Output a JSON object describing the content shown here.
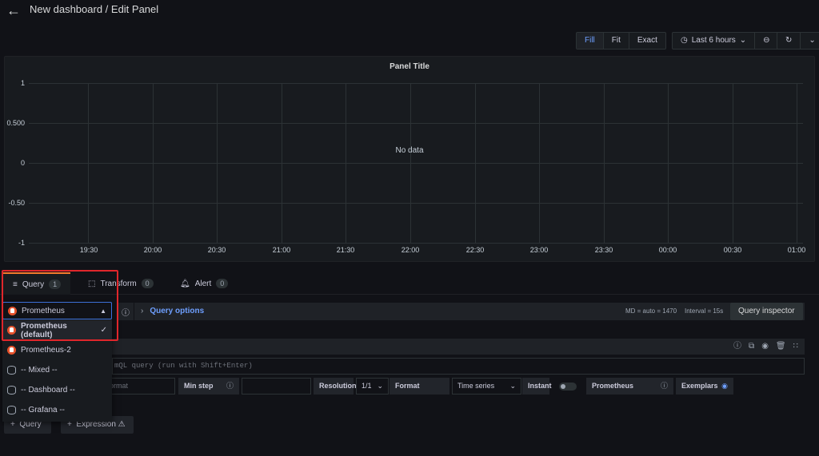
{
  "header": {
    "title": "New dashboard / Edit Panel"
  },
  "toolbar": {
    "fill": "Fill",
    "fit": "Fit",
    "exact": "Exact",
    "time_range": "Last 6 hours"
  },
  "panel": {
    "title": "Panel Title",
    "no_data": "No data",
    "y_ticks": [
      "1",
      "0.500",
      "0",
      "-0.50",
      "-1"
    ],
    "x_ticks": [
      "19:30",
      "20:00",
      "20:30",
      "21:00",
      "21:30",
      "22:00",
      "22:30",
      "23:00",
      "23:30",
      "00:00",
      "00:30",
      "01:00"
    ]
  },
  "tabs": [
    {
      "label": "Query",
      "count": "1"
    },
    {
      "label": "Transform",
      "count": "0"
    },
    {
      "label": "Alert",
      "count": "0"
    }
  ],
  "query_bar": {
    "options_label": "Query options",
    "md": "MD = auto = 1470",
    "interval": "Interval = 15s",
    "inspector": "Query inspector"
  },
  "query": {
    "placeholder": "mQL query (run with Shift+Enter)"
  },
  "options": {
    "format_placeholder": "ormat",
    "min_step": "Min step",
    "resolution": "Resolution",
    "resolution_value": "1/1",
    "format": "Format",
    "format_value": "Time series",
    "instant": "Instant",
    "prometheus": "Prometheus",
    "exemplars": "Exemplars"
  },
  "datasource": {
    "selected": "Prometheus",
    "items": [
      {
        "label": "Prometheus (default)"
      },
      {
        "label": "Prometheus-2"
      },
      {
        "label": "-- Mixed --"
      },
      {
        "label": "-- Dashboard --"
      },
      {
        "label": "-- Grafana --"
      }
    ]
  },
  "add": {
    "query": "Query",
    "expression": "Expression"
  },
  "colors": {
    "accent": "#6e9fff",
    "highlight": "#e0262b",
    "prometheus": "#e6522c",
    "tab_active": "#f77b2c"
  }
}
